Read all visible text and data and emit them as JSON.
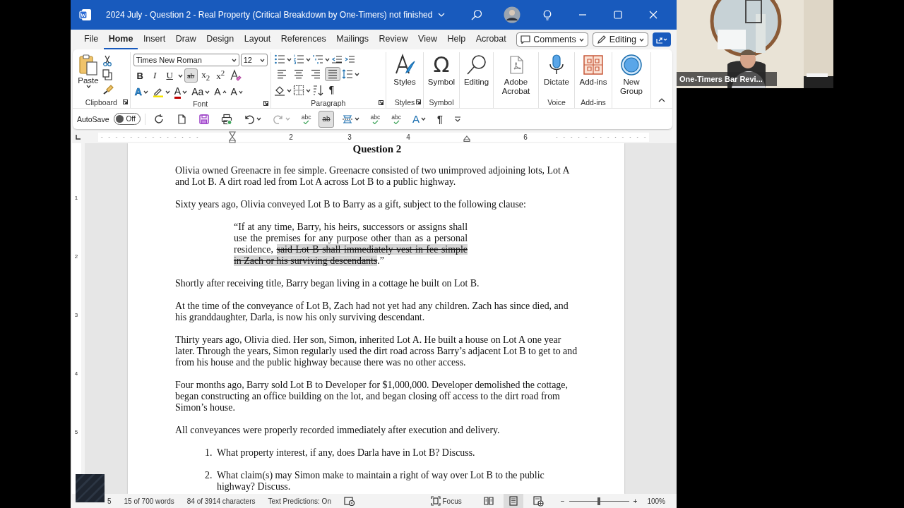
{
  "window": {
    "title": "2024 July - Question 2 - Real Property (Critical Breakdown by One-Timers) not finished"
  },
  "menu_tabs": [
    {
      "label": "File",
      "selected": false
    },
    {
      "label": "Home",
      "selected": true
    },
    {
      "label": "Insert",
      "selected": false
    },
    {
      "label": "Draw",
      "selected": false
    },
    {
      "label": "Design",
      "selected": false
    },
    {
      "label": "Layout",
      "selected": false
    },
    {
      "label": "References",
      "selected": false
    },
    {
      "label": "Mailings",
      "selected": false
    },
    {
      "label": "Review",
      "selected": false
    },
    {
      "label": "View",
      "selected": false
    },
    {
      "label": "Help",
      "selected": false
    },
    {
      "label": "Acrobat",
      "selected": false
    }
  ],
  "comments_button": {
    "label": "Comments"
  },
  "mode_button": {
    "label": "Editing"
  },
  "ribbon": {
    "clipboard": {
      "paste": "Paste",
      "label": "Clipboard"
    },
    "font": {
      "name": "Times New Roman",
      "size": "12",
      "label": "Font",
      "format_buttons": [
        {
          "label": "B",
          "kind": "bold",
          "selected": false
        },
        {
          "label": "I",
          "kind": "italic",
          "selected": false
        },
        {
          "label": "U",
          "kind": "underline",
          "selected": false
        },
        {
          "label": "ab",
          "kind": "strike",
          "selected": true
        },
        {
          "label": "x$_{2}$",
          "kind": "script",
          "selected": false
        },
        {
          "label": "x$^{2}$",
          "kind": "script",
          "selected": false
        }
      ],
      "style_buttons": [
        {
          "label": "A",
          "kind": "effects"
        },
        {
          "kind": "highlight"
        },
        {
          "label": "A",
          "kind": "color"
        },
        {
          "label": "Aa",
          "kind": "case"
        },
        {
          "label": "A",
          "kind": "grow"
        },
        {
          "label": "A",
          "kind": "shrink"
        }
      ]
    },
    "paragraph": {
      "label": "Paragraph",
      "marks": "¶",
      "alignment": [
        {
          "kind": "left",
          "selected": false
        },
        {
          "kind": "center",
          "selected": false
        },
        {
          "kind": "right",
          "selected": false
        },
        {
          "kind": "justify",
          "selected": true
        }
      ]
    },
    "large_buttons": [
      {
        "kind": "styles",
        "label": "Styles",
        "group": "Styles"
      },
      {
        "kind": "symbol",
        "glyph": "Ω",
        "label": "Symbol",
        "group": "Symbol"
      },
      {
        "kind": "editing",
        "label": "Editing"
      },
      {
        "kind": "acrobat",
        "label": "Adobe Acrobat"
      },
      {
        "kind": "dictate",
        "label": "Dictate",
        "group": "Voice"
      },
      {
        "kind": "addins",
        "label": "Add-ins",
        "group": "Add-ins"
      },
      {
        "kind": "newgroup",
        "label": "New Group"
      }
    ]
  },
  "quick_toolbar": {
    "autosave_label": "AutoSave",
    "autosave": {
      "on": false,
      "label": "Off"
    },
    "items": [
      {
        "kind": "refresh",
        "selected": false,
        "disabled": false
      },
      {
        "kind": "new",
        "selected": false,
        "disabled": false
      },
      {
        "kind": "save",
        "selected": false,
        "disabled": false
      },
      {
        "kind": "print",
        "selected": false,
        "disabled": false
      },
      {
        "kind": "undo",
        "selected": false,
        "disabled": false
      },
      {
        "kind": "redo",
        "selected": false,
        "disabled": true
      },
      {
        "kind": "spell",
        "label": "abc",
        "selected": false,
        "disabled": false
      },
      {
        "kind": "strike",
        "label": "ab",
        "selected": true,
        "disabled": false
      },
      {
        "kind": "borders",
        "selected": false,
        "disabled": false
      },
      {
        "kind": "spell",
        "label": "abc",
        "selected": false,
        "disabled": false
      },
      {
        "kind": "spell",
        "label": "abc",
        "selected": false,
        "disabled": false
      },
      {
        "kind": "font",
        "label": "A",
        "selected": false,
        "disabled": false
      },
      {
        "kind": "marks",
        "label": "¶",
        "selected": false,
        "disabled": false
      },
      {
        "kind": "more",
        "selected": false,
        "disabled": false
      }
    ]
  },
  "ruler": {
    "marks": [
      {
        "kind": "first_indent"
      },
      {
        "kind": "number",
        "label": "2"
      },
      {
        "kind": "number",
        "label": "3"
      },
      {
        "kind": "number",
        "label": "4"
      },
      {
        "kind": "right_indent"
      },
      {
        "kind": "number",
        "label": "6"
      }
    ]
  },
  "vertical_ruler": {
    "numbers": [
      "1",
      "2",
      "3",
      "4",
      "5"
    ]
  },
  "document": {
    "heading": "Question 2",
    "blocks": [
      {
        "kind": "paragraph",
        "text": "Olivia owned Greenacre in fee simple. Greenacre consisted of two unimproved adjoining lots, Lot A and Lot B. A dirt road led from Lot A across Lot B to a public highway."
      },
      {
        "kind": "paragraph",
        "text": "Sixty years ago, Olivia conveyed Lot B to Barry as a gift, subject to the following clause:"
      },
      {
        "kind": "quote",
        "segments": [
          {
            "text": "“If at any time, Barry, his heirs, successors or assigns shall use the premises for any purpose other than as a personal residence, ",
            "struck": false
          },
          {
            "text": "said Lot B shall immediately vest in fee simple in Zach or his surviving descendants",
            "struck": true
          },
          {
            "text": ".”",
            "struck": false
          }
        ]
      },
      {
        "kind": "paragraph",
        "text": "Shortly after receiving title, Barry began living in a cottage he built on Lot B."
      },
      {
        "kind": "paragraph",
        "text": "At the time of the conveyance of Lot B, Zach had not yet had any children. Zach has since died, and his granddaughter, Darla, is now his only surviving descendant."
      },
      {
        "kind": "paragraph",
        "text": "Thirty years ago, Olivia died. Her son, Simon, inherited Lot A. He built a house on Lot A one year later. Through the years, Simon regularly used the dirt road across Barry’s adjacent Lot B to get to and from his house and the public highway because there was no other access."
      },
      {
        "kind": "paragraph",
        "text": "Four months ago, Barry sold Lot B to Developer for $1,000,000. Developer demolished the cottage, began constructing an office building on the lot, and began closing off access to the dirt road from Simon’s house."
      },
      {
        "kind": "paragraph",
        "text": "All conveyances were properly recorded immediately after execution and delivery."
      },
      {
        "kind": "question",
        "number": "1.",
        "text": "What property interest, if any, does Darla have in Lot B? Discuss."
      },
      {
        "kind": "question",
        "number": "2.",
        "text": "What claim(s) may Simon make to maintain a right of way over Lot B to the public highway? Discuss."
      }
    ]
  },
  "status_bar": {
    "page": "5",
    "words": "15 of 700 words",
    "characters": "84 of 3914 characters",
    "predictions": "Text Predictions: On",
    "focus": "Focus",
    "views": [
      {
        "kind": "read",
        "selected": false
      },
      {
        "kind": "print",
        "selected": true
      },
      {
        "kind": "web",
        "selected": false
      }
    ],
    "zoom_out": "−",
    "zoom_in": "+",
    "zoom": {
      "level": 0.5,
      "reading": "100%"
    }
  },
  "video_tile": {
    "name": "One-Timers Bar Revi..."
  }
}
